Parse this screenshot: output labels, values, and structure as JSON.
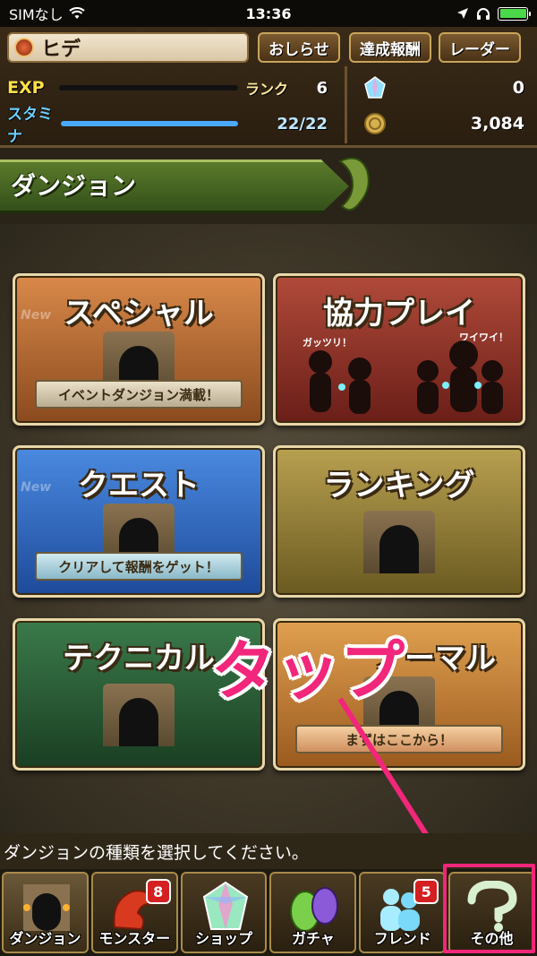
{
  "status_bar": {
    "carrier": "SIMなし",
    "time": "13:36"
  },
  "player": {
    "name": "ヒデ"
  },
  "header_buttons": {
    "news": "おしらせ",
    "rewards": "達成報酬",
    "radar": "レーダー"
  },
  "stats": {
    "exp_label": "EXP",
    "rank_label": "ランク",
    "rank_value": "6",
    "exp_progress": 0.0,
    "stamina_label": "スタミナ",
    "stamina_value": "22/22",
    "stamina_progress": 1.0
  },
  "resources": {
    "magic_stones": "0",
    "coins": "3,084"
  },
  "section_title": "ダンジョン",
  "dungeon_cards": [
    {
      "title": "スペシャル",
      "ribbon": "イベントダンジョン満載！",
      "new_tag": "New"
    },
    {
      "title": "協力プレイ",
      "ribbon": "",
      "new_tag": "",
      "left_bubble": "ガッツリ！",
      "right_bubble": "ワイワイ！"
    },
    {
      "title": "クエスト",
      "ribbon": "クリアして報酬をゲット！",
      "new_tag": "New"
    },
    {
      "title": "ランキング",
      "ribbon": "",
      "new_tag": ""
    },
    {
      "title": "テクニカル",
      "ribbon": "",
      "new_tag": ""
    },
    {
      "title": "ノーマル",
      "ribbon": "まずはここから！",
      "new_tag": ""
    }
  ],
  "annotation": {
    "tap": "タップ"
  },
  "instruction": "ダンジョンの種類を選択してください。",
  "bottom_nav": [
    {
      "label": "ダンジョン",
      "badge": ""
    },
    {
      "label": "モンスター",
      "badge": "8"
    },
    {
      "label": "ショップ",
      "badge": ""
    },
    {
      "label": "ガチャ",
      "badge": ""
    },
    {
      "label": "フレンド",
      "badge": "5"
    },
    {
      "label": "その他",
      "badge": ""
    }
  ],
  "colors": {
    "highlight": "#f2267a",
    "stamina_bar": "#4aa8ff",
    "banner": "#4a6a22"
  }
}
